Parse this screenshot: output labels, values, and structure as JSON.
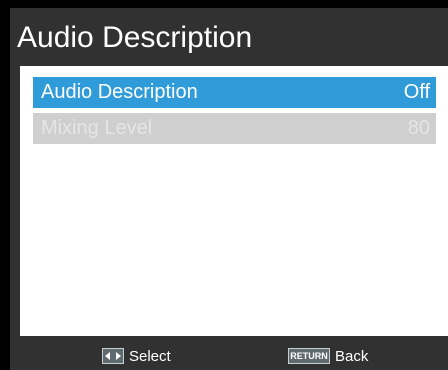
{
  "screen": {
    "title": "Audio Description"
  },
  "menu": {
    "items": [
      {
        "label": "Audio Description",
        "value": "Off",
        "state": "selected"
      },
      {
        "label": "Mixing Level",
        "value": "80",
        "state": "disabled"
      }
    ]
  },
  "footer": {
    "select_label": "Select",
    "select_icon": "left-right-arrows-icon",
    "back_label": "Back",
    "return_key_label": "RETURN"
  },
  "colors": {
    "background": "#000000",
    "panel": "#313131",
    "content": "#ffffff",
    "highlight": "#2f9bd9",
    "disabled_row": "#cfcfcf",
    "disabled_text": "#e5e5e5"
  }
}
